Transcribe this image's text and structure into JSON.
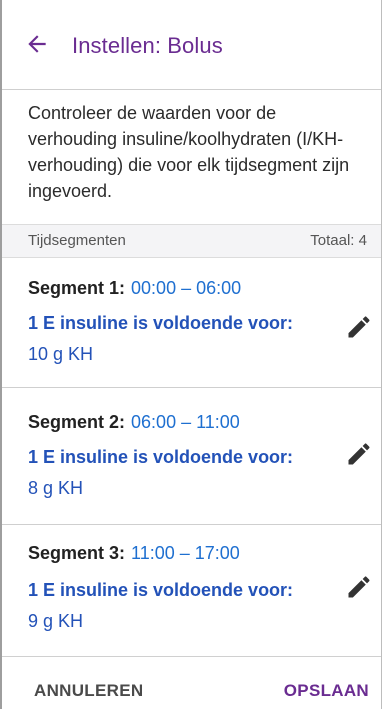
{
  "header": {
    "title": "Instellen: Bolus",
    "back_icon": "arrow-left-icon"
  },
  "intro": "Controleer de waarden voor de verhouding insuline/koolhydraten (I/KH-verhouding) die voor elk tijdsegment zijn ingevoerd.",
  "segments_bar": {
    "label": "Tijdsegmenten",
    "total": "Totaal: 4"
  },
  "segments": [
    {
      "name": "Segment 1:",
      "time": "00:00 – 06:00",
      "ratio_label": "1 E insuline is voldoende voor:",
      "amount": "10 g KH",
      "edit_icon": "pencil-icon"
    },
    {
      "name": "Segment 2:",
      "time": "06:00 – 11:00",
      "ratio_label": "1 E insuline is voldoende voor:",
      "amount": "8 g KH",
      "edit_icon": "pencil-icon"
    },
    {
      "name": "Segment 3:",
      "time": "11:00 – 17:00",
      "ratio_label": "1 E insuline is voldoende voor:",
      "amount": "9 g KH",
      "edit_icon": "pencil-icon"
    }
  ],
  "footer": {
    "cancel": "ANNULEREN",
    "save": "OPSLAAN"
  },
  "colors": {
    "accent": "#6a2c91",
    "link_blue": "#2352b8",
    "time_blue": "#1e6fd0"
  }
}
